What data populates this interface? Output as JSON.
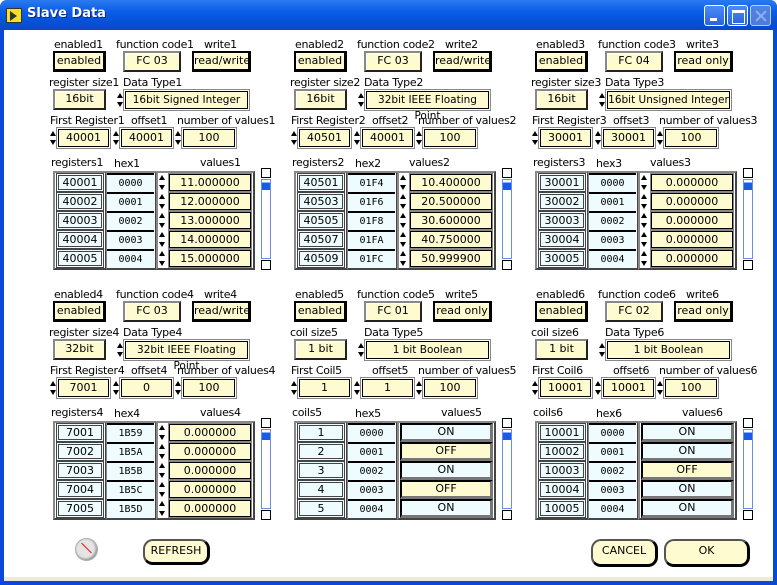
{
  "window": {
    "title": "Slave Data",
    "controls": [
      "minimize-icon",
      "maximize-icon",
      "close-icon"
    ]
  },
  "panels": [
    {
      "enabled_label": "enabled1",
      "enabled_value": "enabled",
      "fc_label": "function code1",
      "fc_value": "FC 03",
      "write_label": "write1",
      "write_value": "read/write",
      "size_label": "register size1",
      "size_value": "16bit",
      "dtype_label": "Data Type1",
      "dtype_value": "16bit Signed Integer",
      "first_label": "First Register1",
      "first_value": "40001",
      "offset_label": "offset1",
      "offset_value": "40001",
      "count_label": "number of values1",
      "count_value": "100",
      "col_reg": "registers1",
      "col_hex": "hex1",
      "col_val": "values1",
      "kind": "numeric",
      "rows": [
        {
          "reg": "40001",
          "hex": "0000",
          "val": "11.000000"
        },
        {
          "reg": "40002",
          "hex": "0001",
          "val": "12.000000"
        },
        {
          "reg": "40003",
          "hex": "0002",
          "val": "13.000000"
        },
        {
          "reg": "40004",
          "hex": "0003",
          "val": "14.000000"
        },
        {
          "reg": "40005",
          "hex": "0004",
          "val": "15.000000"
        }
      ]
    },
    {
      "enabled_label": "enabled2",
      "enabled_value": "enabled",
      "fc_label": "function code2",
      "fc_value": "FC 03",
      "write_label": "write2",
      "write_value": "read/write",
      "size_label": "register size2",
      "size_value": "16bit",
      "dtype_label": "Data Type2",
      "dtype_value": "32bit IEEE Floating Point",
      "first_label": "First Register2",
      "first_value": "40501",
      "offset_label": "offset2",
      "offset_value": "40001",
      "count_label": "number of values2",
      "count_value": "100",
      "col_reg": "registers2",
      "col_hex": "hex2",
      "col_val": "values2",
      "kind": "numeric",
      "rows": [
        {
          "reg": "40501",
          "hex": "01F4",
          "val": "10.400000"
        },
        {
          "reg": "40503",
          "hex": "01F6",
          "val": "20.500000"
        },
        {
          "reg": "40505",
          "hex": "01F8",
          "val": "30.600000"
        },
        {
          "reg": "40507",
          "hex": "01FA",
          "val": "40.750000"
        },
        {
          "reg": "40509",
          "hex": "01FC",
          "val": "50.999900"
        }
      ]
    },
    {
      "enabled_label": "enabled3",
      "enabled_value": "enabled",
      "fc_label": "function code3",
      "fc_value": "FC 04",
      "write_label": "write3",
      "write_value": "read only",
      "size_label": "register size3",
      "size_value": "16bit",
      "dtype_label": "Data Type3",
      "dtype_value": "16bit Unsigned Integer",
      "first_label": "First Register3",
      "first_value": "30001",
      "offset_label": "offset3",
      "offset_value": "30001",
      "count_label": "number of values3",
      "count_value": "100",
      "col_reg": "registers3",
      "col_hex": "hex3",
      "col_val": "values3",
      "kind": "numeric",
      "rows": [
        {
          "reg": "30001",
          "hex": "0000",
          "val": "0.000000"
        },
        {
          "reg": "30002",
          "hex": "0001",
          "val": "0.000000"
        },
        {
          "reg": "30003",
          "hex": "0002",
          "val": "0.000000"
        },
        {
          "reg": "30004",
          "hex": "0003",
          "val": "0.000000"
        },
        {
          "reg": "30005",
          "hex": "0004",
          "val": "0.000000"
        }
      ]
    },
    {
      "enabled_label": "enabled4",
      "enabled_value": "enabled",
      "fc_label": "function code4",
      "fc_value": "FC 03",
      "write_label": "write4",
      "write_value": "read/write",
      "size_label": "register size4",
      "size_value": "32bit",
      "dtype_label": "Data Type4",
      "dtype_value": "32bit IEEE Floating Point",
      "first_label": "First Register4",
      "first_value": "7001",
      "offset_label": "offset4",
      "offset_value": "0",
      "count_label": "number of values4",
      "count_value": "100",
      "col_reg": "registers4",
      "col_hex": "hex4",
      "col_val": "values4",
      "kind": "numeric",
      "rows": [
        {
          "reg": "7001",
          "hex": "1B59",
          "val": "0.000000"
        },
        {
          "reg": "7002",
          "hex": "1B5A",
          "val": "0.000000"
        },
        {
          "reg": "7003",
          "hex": "1B5B",
          "val": "0.000000"
        },
        {
          "reg": "7004",
          "hex": "1B5C",
          "val": "0.000000"
        },
        {
          "reg": "7005",
          "hex": "1B5D",
          "val": "0.000000"
        }
      ]
    },
    {
      "enabled_label": "enabled5",
      "enabled_value": "enabled",
      "fc_label": "function code5",
      "fc_value": "FC 01",
      "write_label": "write5",
      "write_value": "read only",
      "size_label": "coil size5",
      "size_value": "1 bit",
      "dtype_label": "Data Type5",
      "dtype_value": "1 bit Boolean",
      "first_label": "First Coil5",
      "first_value": "1",
      "offset_label": "offset5",
      "offset_value": "1",
      "count_label": "number of values5",
      "count_value": "100",
      "col_reg": "coils5",
      "col_hex": "hex5",
      "col_val": "values5",
      "kind": "boolean",
      "rows": [
        {
          "reg": "1",
          "hex": "0000",
          "val": "ON"
        },
        {
          "reg": "2",
          "hex": "0001",
          "val": "OFF"
        },
        {
          "reg": "3",
          "hex": "0002",
          "val": "ON"
        },
        {
          "reg": "4",
          "hex": "0003",
          "val": "OFF"
        },
        {
          "reg": "5",
          "hex": "0004",
          "val": "ON"
        }
      ]
    },
    {
      "enabled_label": "enabled6",
      "enabled_value": "enabled",
      "fc_label": "function code6",
      "fc_value": "FC 02",
      "write_label": "write6",
      "write_value": "read only",
      "size_label": "coil size6",
      "size_value": "1 bit",
      "dtype_label": "Data Type6",
      "dtype_value": "1 bit Boolean",
      "first_label": "First Coil6",
      "first_value": "10001",
      "offset_label": "offset6",
      "offset_value": "10001",
      "count_label": "number of values6",
      "count_value": "100",
      "col_reg": "coils6",
      "col_hex": "hex6",
      "col_val": "values6",
      "kind": "boolean",
      "rows": [
        {
          "reg": "10001",
          "hex": "0000",
          "val": "ON"
        },
        {
          "reg": "10002",
          "hex": "0001",
          "val": "ON"
        },
        {
          "reg": "10003",
          "hex": "0002",
          "val": "OFF"
        },
        {
          "reg": "10004",
          "hex": "0003",
          "val": "ON"
        },
        {
          "reg": "10005",
          "hex": "0004",
          "val": "ON"
        }
      ]
    }
  ],
  "buttons": {
    "refresh": "REFRESH",
    "cancel": "CANCEL",
    "ok": "OK"
  },
  "colors": {
    "field_bg": "#fffbd0",
    "cell_bg": "#eefcff",
    "title_bar": "#0a5ce8",
    "scroll_thumb": "#1a5ae8"
  }
}
